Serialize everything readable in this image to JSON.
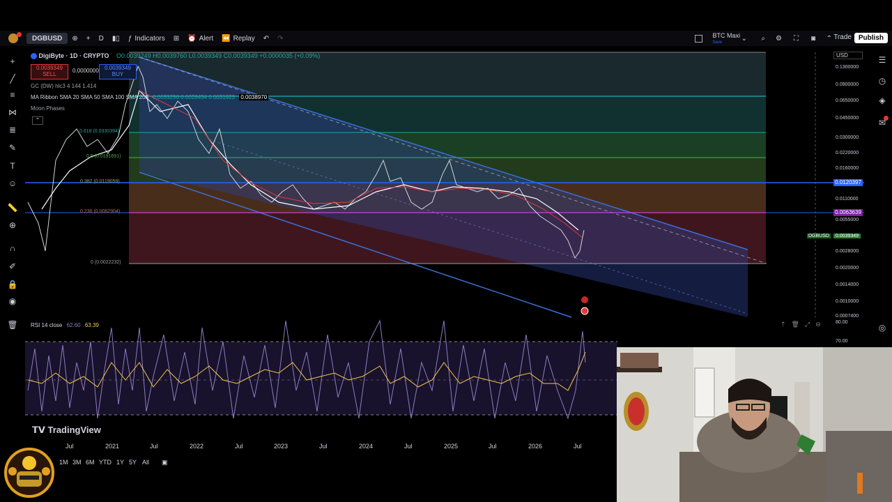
{
  "toolbar": {
    "symbol": "DGBUSD",
    "interval": "D",
    "indicators": "Indicators",
    "alert": "Alert",
    "replay": "Replay",
    "layout_name": "BTC Maxi",
    "layout_sub": "Save",
    "trade": "Trade",
    "publish": "Publish"
  },
  "chart": {
    "title": "DigiByte · 1D · CRYPTO",
    "ohlc": "O0.0039249 H0.0039760 L0.0039349 C0.0039349 +0.0000035 (+0.09%)",
    "sell_price": "0.0039349",
    "sell_label": "SELL",
    "spread": "0.0000000",
    "buy_price": "0.0039349",
    "buy_label": "BUY",
    "indicator_gc": "GC (DW) hlc3 4 144 1.414",
    "indicator_ma": "MA Ribbon SMA 20 SMA 50 SMA 100 SMA 200",
    "indicator_ma_values": "0.0033250  0.0028434  0.0031923",
    "indicator_ma_last": "0.0038970",
    "indicator_moon": "Moon Phases",
    "currency": "USD",
    "fib_labels": [
      "0.618 (0.0330394)",
      "0.5 (0.0191691)",
      "0.382 (0.0119059)",
      "0.236 (0.0062904)",
      "0 (0.0022232)"
    ],
    "price_tag_blue": "0.0120397",
    "price_tag_purple": "0.0063639",
    "symbol_tag": "DGBUSD",
    "symbol_tag_value": "0.0039349",
    "y_ticks": [
      "0.1300000",
      "0.0900000",
      "0.0650000",
      "0.0450000",
      "0.0300000",
      "0.0220000",
      "0.0160000",
      "0.0110000",
      "0.0055000",
      "0.0028000",
      "0.0020000",
      "0.0014000",
      "0.0010000",
      "0.0007400"
    ],
    "rsi_label": "RSI 14 close",
    "rsi_v1": "62.60",
    "rsi_v2": "63.39",
    "rsi_ticks": [
      "80.00",
      "70.00"
    ],
    "x_ticks": [
      "Jul",
      "2021",
      "Jul",
      "2022",
      "Jul",
      "2023",
      "Jul",
      "2024",
      "Jul",
      "2025",
      "Jul",
      "2026",
      "Jul"
    ],
    "periods": [
      "1M",
      "3M",
      "6M",
      "YTD",
      "1Y",
      "5Y",
      "All"
    ],
    "watermark": "TradingView"
  },
  "colors": {
    "channel": "#3a6fd8",
    "fib_blue": "#2962ff",
    "fib_purple": "#9c27b0",
    "rsi_line": "#8e7cc3",
    "rsi_ma": "#f2c94c"
  }
}
